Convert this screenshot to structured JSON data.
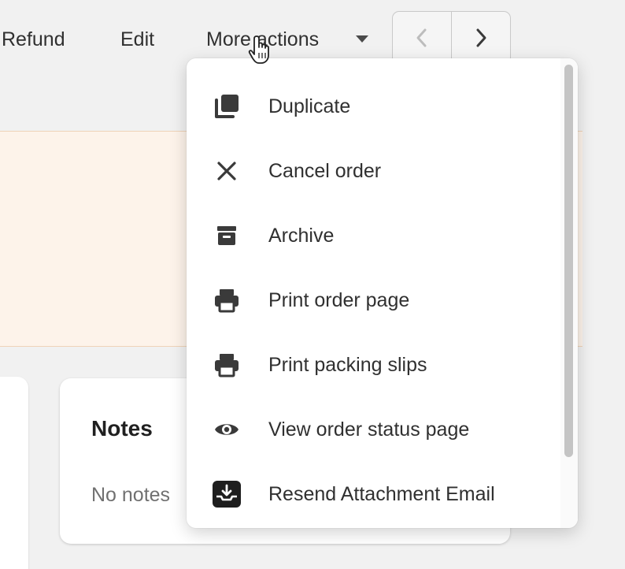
{
  "toolbar": {
    "refund_label": "Refund",
    "edit_label": "Edit",
    "more_actions_label": "More actions",
    "prev_icon": "chevron-left-icon",
    "next_icon": "chevron-right-icon"
  },
  "notes": {
    "title": "Notes",
    "empty_text": "No notes"
  },
  "menu": {
    "items": [
      {
        "label": "Duplicate",
        "icon": "duplicate-icon"
      },
      {
        "label": "Cancel order",
        "icon": "close-icon"
      },
      {
        "label": "Archive",
        "icon": "archive-icon"
      },
      {
        "label": "Print order page",
        "icon": "printer-icon"
      },
      {
        "label": "Print packing slips",
        "icon": "printer-icon"
      },
      {
        "label": "View order status page",
        "icon": "eye-icon"
      },
      {
        "label": "Resend Attachment Email",
        "icon": "download-tray-icon"
      }
    ]
  },
  "colors": {
    "banner_bg": "#fdf3ea",
    "text": "#303030",
    "icon": "#3a3a3a",
    "page_bg": "#f1f1f1"
  }
}
